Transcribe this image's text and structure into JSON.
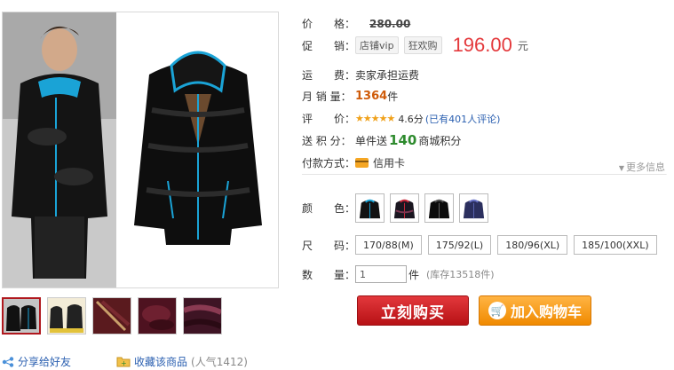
{
  "gallery": {
    "thumb_count": 5,
    "share_label": "分享给好友",
    "favorite_label": "收藏该商品",
    "popularity": "(人气1412)"
  },
  "price": {
    "label": "价　　格：",
    "original": "280.00"
  },
  "promo": {
    "label": "促　　销：",
    "tag1": "店铺vip",
    "tag2": "狂欢购",
    "price": "196.00",
    "currency": "元"
  },
  "shipping": {
    "label": "运　　费：",
    "value": "卖家承担运费"
  },
  "monthly_sales": {
    "label": "月 销 量：",
    "value": "1364",
    "unit": "件"
  },
  "rating": {
    "label": "评　　价：",
    "stars": "★★★★★",
    "score": "4.6分",
    "reviews": "(已有401人评论)"
  },
  "points": {
    "label": "送 积 分：",
    "prefix": "单件送",
    "value": "140",
    "suffix": "商城积分"
  },
  "payment": {
    "label": "付款方式：",
    "method": "信用卡",
    "more": "更多信息"
  },
  "color": {
    "label": "颜　　色："
  },
  "size": {
    "label": "尺　　码：",
    "options": [
      "170/88(M)",
      "175/92(L)",
      "180/96(XL)",
      "185/100(XXL)"
    ]
  },
  "quantity": {
    "label": "数　　量：",
    "value": "1",
    "unit": "件",
    "stock": "(库存13518件)"
  },
  "actions": {
    "buy_now": "立刻购买",
    "add_cart": "加入购物车"
  },
  "colors": {
    "price_red": "#e4393c",
    "accent_orange": "#f08a00",
    "link_blue": "#2a5fb0"
  }
}
